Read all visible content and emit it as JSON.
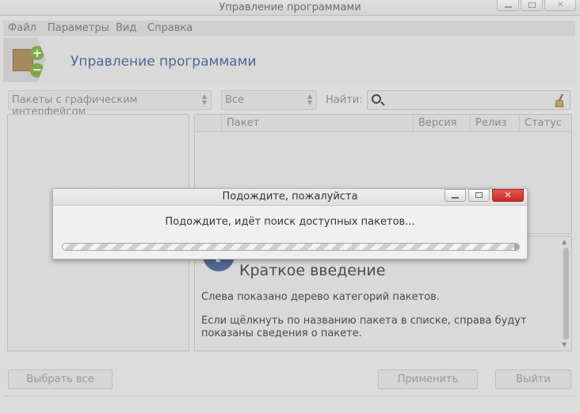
{
  "window": {
    "title": "Управление программами"
  },
  "menu": [
    "Файл",
    "Параметры",
    "Вид",
    "Справка"
  ],
  "header": {
    "title": "Управление программами"
  },
  "filters": {
    "category_combo": "Пакеты с графическим интерфейсом",
    "status_combo": "Все",
    "search_label": "Найти:",
    "search_value": ""
  },
  "package_list": {
    "columns": [
      "",
      "Пакет",
      "Версия",
      "Релиз",
      "Статус"
    ]
  },
  "info": {
    "title": "Краткое введение",
    "paragraph1": "Слева показано дерево категорий пакетов.",
    "paragraph2": "Если щёлкнуть по названию пакета в списке, справа будут показаны сведения о пакете."
  },
  "buttons": {
    "select_all": "Выбрать все",
    "apply": "Применить",
    "quit": "Выйти"
  },
  "dialog": {
    "title": "Подождите, пожалуйста",
    "message": "Подождите, идёт поиск доступных пакетов...",
    "progress": 0.0
  },
  "colors": {
    "close_button": "#d9453c",
    "header_title": "#4a6a9a",
    "info_icon": "#4f6a92"
  },
  "icons": [
    "package-manager-icon",
    "search-icon",
    "clear-search-icon",
    "info-icon",
    "close-icon",
    "minimize-icon",
    "maximize-icon"
  ]
}
